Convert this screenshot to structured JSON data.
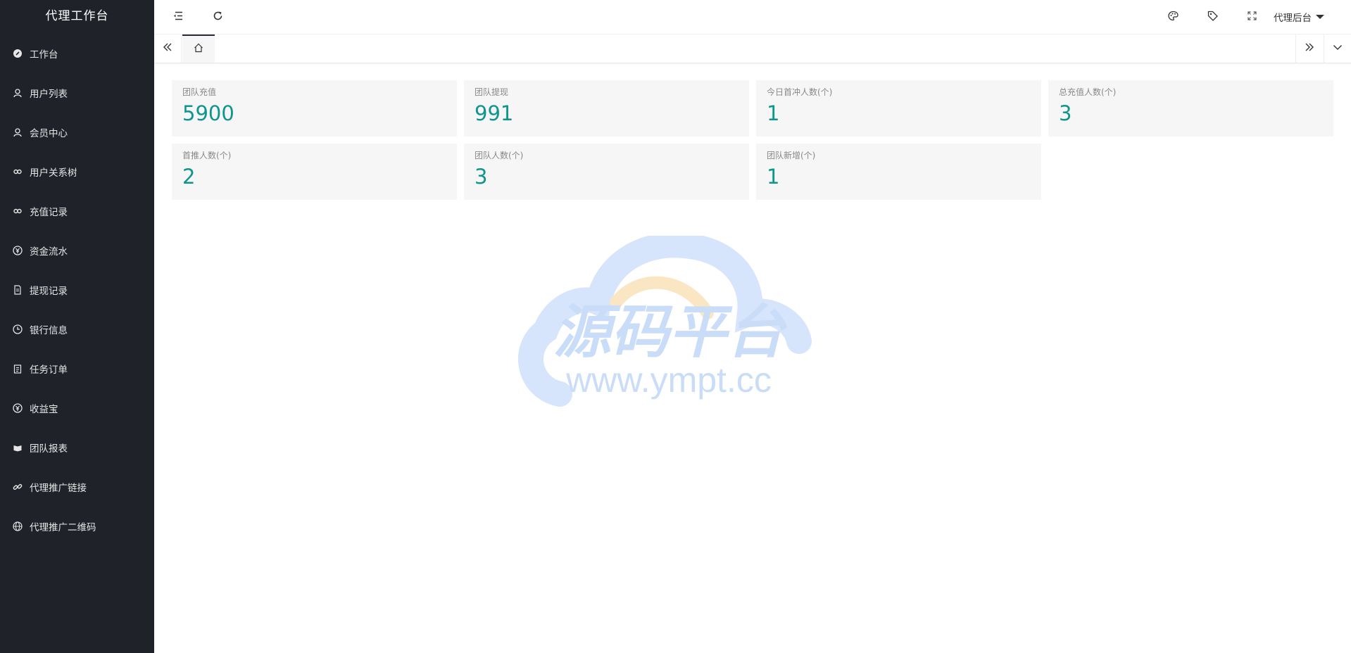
{
  "sidebar": {
    "title": "代理工作台",
    "items": [
      {
        "label": "工作台",
        "icon": "dashboard-icon"
      },
      {
        "label": "用户列表",
        "icon": "user-icon"
      },
      {
        "label": "会员中心",
        "icon": "user-icon"
      },
      {
        "label": "用户关系树",
        "icon": "link-loop-icon"
      },
      {
        "label": "充值记录",
        "icon": "link-loop-icon"
      },
      {
        "label": "资金流水",
        "icon": "yen-circle-icon"
      },
      {
        "label": "提现记录",
        "icon": "document-icon"
      },
      {
        "label": "银行信息",
        "icon": "clock-icon"
      },
      {
        "label": "任务订单",
        "icon": "clipboard-icon"
      },
      {
        "label": "收益宝",
        "icon": "yen-circle-icon"
      },
      {
        "label": "团队报表",
        "icon": "report-icon"
      },
      {
        "label": "代理推广链接",
        "icon": "chain-link-icon"
      },
      {
        "label": "代理推广二维码",
        "icon": "globe-icon"
      }
    ]
  },
  "header": {
    "user_label": "代理后台"
  },
  "stats": [
    {
      "label": "团队充值",
      "value": "5900"
    },
    {
      "label": "团队提现",
      "value": "991"
    },
    {
      "label": "今日首冲人数(个)",
      "value": "1"
    },
    {
      "label": "总充值人数(个)",
      "value": "3"
    },
    {
      "label": "首推人数(个)",
      "value": "2"
    },
    {
      "label": "团队人数(个)",
      "value": "3"
    },
    {
      "label": "团队新增(个)",
      "value": "1"
    }
  ],
  "watermark": {
    "title": "源码平台",
    "url": "www.ympt.cc"
  },
  "colors": {
    "sidebar_bg": "#20222a",
    "accent_value": "#0f968c",
    "card_bg": "#f6f6f6"
  }
}
